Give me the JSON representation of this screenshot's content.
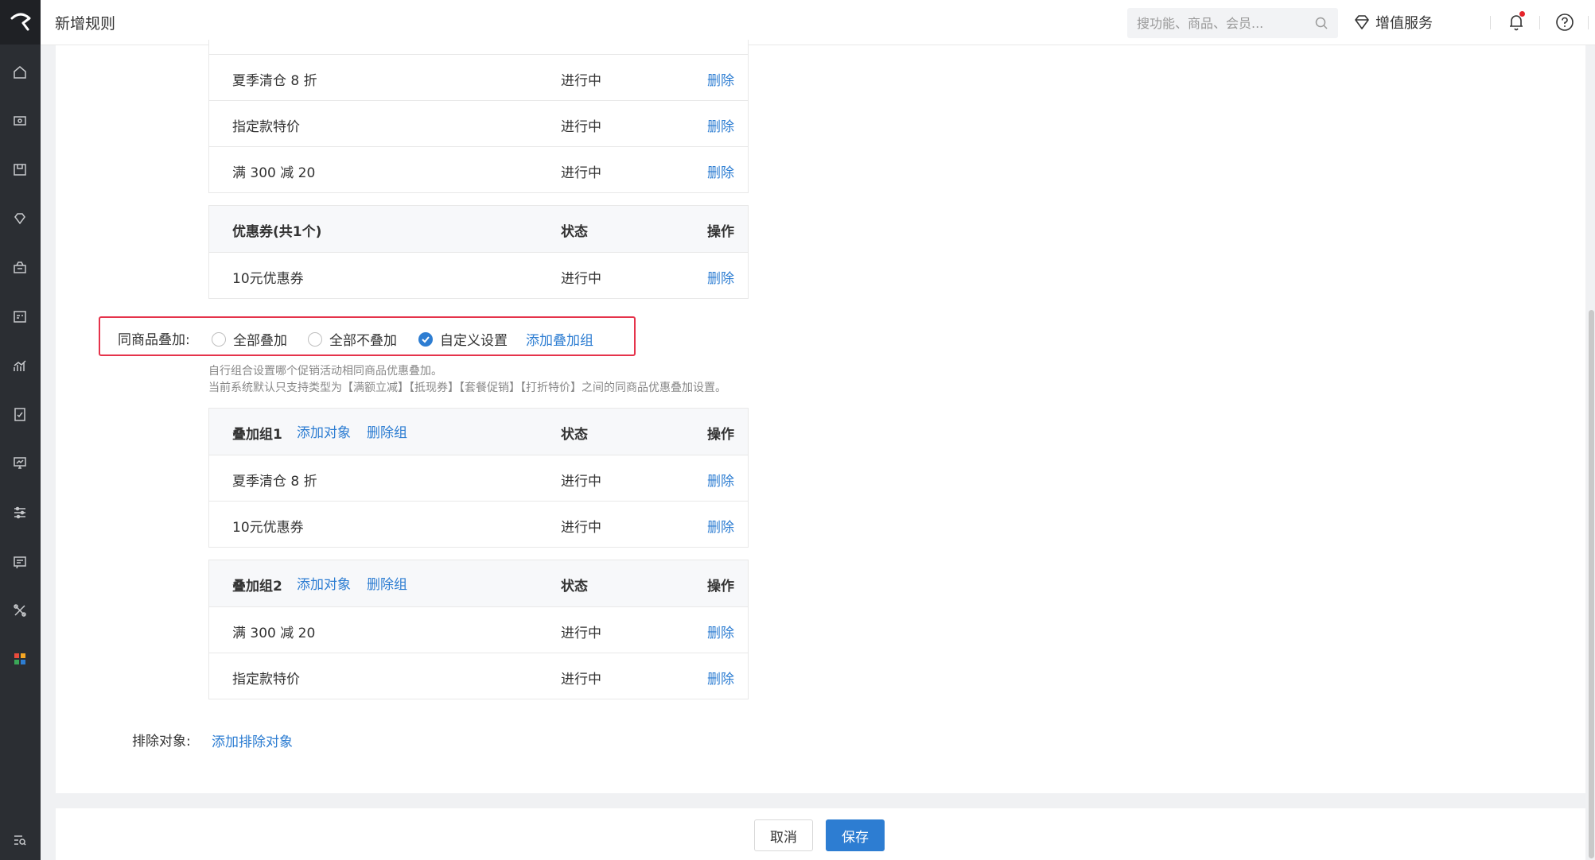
{
  "header": {
    "title": "新增规则",
    "search_placeholder": "搜功能、商品、会员...",
    "value_added_label": "增值服务"
  },
  "sidebar": {
    "icons": [
      "home-icon",
      "money-icon",
      "box-icon",
      "diamond-icon",
      "truck-icon",
      "id-card-icon",
      "chart-icon",
      "checklist-icon",
      "monitor-icon",
      "sliders-icon",
      "message-icon",
      "tools-icon",
      "apps-icon",
      "search-list-icon"
    ]
  },
  "promo_table": {
    "rows": [
      {
        "name": "夏季清仓 8 折",
        "status": "进行中",
        "op": "删除"
      },
      {
        "name": "指定款特价",
        "status": "进行中",
        "op": "删除"
      },
      {
        "name": "满 300 减 20",
        "status": "进行中",
        "op": "删除"
      }
    ]
  },
  "coupon_table": {
    "header": {
      "name": "优惠券(共1个)",
      "status": "状态",
      "op": "操作"
    },
    "rows": [
      {
        "name": "10元优惠券",
        "status": "进行中",
        "op": "删除"
      }
    ]
  },
  "stacking": {
    "label": "同商品叠加:",
    "options": [
      "全部叠加",
      "全部不叠加",
      "自定义设置"
    ],
    "selected": "自定义设置",
    "add_group": "添加叠加组",
    "hint1": "自行组合设置哪个促销活动相同商品优惠叠加。",
    "hint2": "当前系统默认只支持类型为【满额立减】【抵现券】【套餐促销】【打折特价】之间的同商品优惠叠加设置。"
  },
  "groups": [
    {
      "header": {
        "name": "叠加组1",
        "add_object": "添加对象",
        "delete_group": "删除组",
        "status": "状态",
        "op": "操作"
      },
      "rows": [
        {
          "name": "夏季清仓 8 折",
          "status": "进行中",
          "op": "删除"
        },
        {
          "name": "10元优惠券",
          "status": "进行中",
          "op": "删除"
        }
      ]
    },
    {
      "header": {
        "name": "叠加组2",
        "add_object": "添加对象",
        "delete_group": "删除组",
        "status": "状态",
        "op": "操作"
      },
      "rows": [
        {
          "name": "满 300 减 20",
          "status": "进行中",
          "op": "删除"
        },
        {
          "name": "指定款特价",
          "status": "进行中",
          "op": "删除"
        }
      ]
    }
  ],
  "exclude": {
    "label": "排除对象:",
    "link": "添加排除对象"
  },
  "footer": {
    "cancel": "取消",
    "save": "保存"
  },
  "colors": {
    "accent": "#2d7dd2",
    "highlight_border": "#e5334b",
    "sidebar_bg": "#2b2e33",
    "notification_dot": "#e5242b"
  }
}
